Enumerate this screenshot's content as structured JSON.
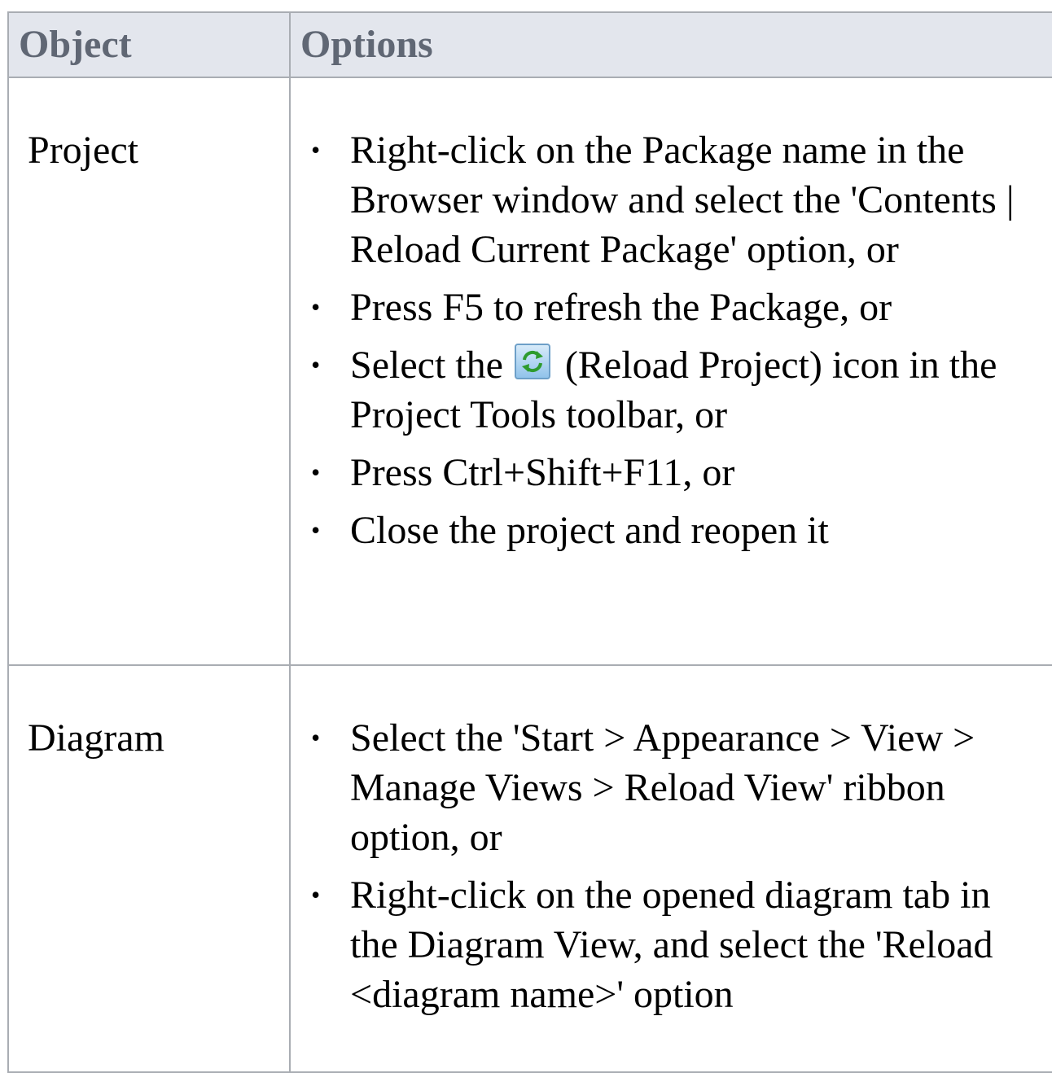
{
  "table": {
    "headers": {
      "object": "Object",
      "options": "Options"
    },
    "rows": [
      {
        "object": "Project",
        "options": [
          {
            "text": "Right-click on the Package name in the Browser window and select the 'Contents | Reload Current Package' option, or"
          },
          {
            "text": "Press F5 to refresh the Package, or"
          },
          {
            "text_before": "Select the",
            "icon": "reload-project-icon",
            "text_after": "(Reload Project) icon in the Project Tools toolbar, or"
          },
          {
            "text": "Press Ctrl+Shift+F11, or"
          },
          {
            "text": "Close the project and reopen it"
          }
        ]
      },
      {
        "object": "Diagram",
        "options": [
          {
            "text": "Select the 'Start > Appearance > View > Manage Views > Reload View' ribbon option, or"
          },
          {
            "text": "Right-click on the opened diagram tab in the Diagram View, and select the 'Reload <diagram name>' option"
          }
        ]
      }
    ]
  },
  "bullet_char": "•"
}
